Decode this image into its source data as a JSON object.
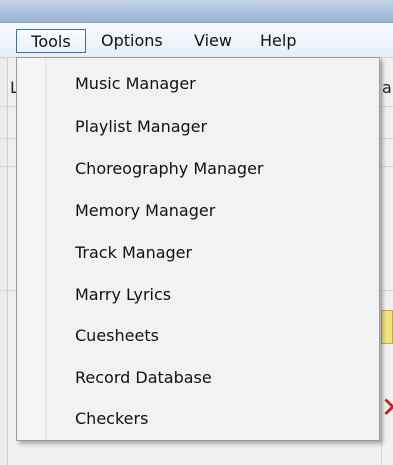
{
  "menubar": {
    "items": [
      {
        "label": "Tools"
      },
      {
        "label": "Options"
      },
      {
        "label": "View"
      },
      {
        "label": "Help"
      }
    ]
  },
  "background": {
    "partial_left_text": "L",
    "partial_right_text": "ar"
  },
  "dropdown": {
    "items": [
      {
        "label": "Music Manager"
      },
      {
        "label": "Playlist Manager"
      },
      {
        "label": "Choreography Manager"
      },
      {
        "label": "Memory Manager"
      },
      {
        "label": "Track Manager"
      },
      {
        "label": "Marry Lyrics"
      },
      {
        "label": "Cuesheets"
      },
      {
        "label": "Record Database"
      },
      {
        "label": "Checkers"
      }
    ]
  }
}
